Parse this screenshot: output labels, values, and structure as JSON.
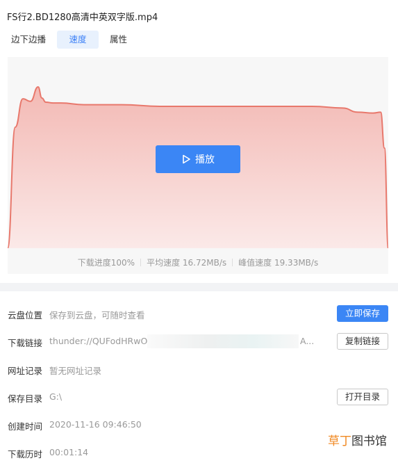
{
  "file": {
    "title": "FS行2.BD1280高清中英双字版.mp4"
  },
  "tabs": [
    {
      "label": "边下边播",
      "active": false
    },
    {
      "label": "速度",
      "active": true
    },
    {
      "label": "属性",
      "active": false
    }
  ],
  "player": {
    "play_label": "播放",
    "play_icon": "play-icon"
  },
  "chart_data": {
    "type": "area",
    "title": "",
    "xlabel": "",
    "ylabel": "",
    "y_unit": "MB/s",
    "ylim": [
      0,
      19.33
    ],
    "x": [
      0,
      2,
      4,
      6,
      8,
      9,
      10,
      12,
      14,
      20,
      30,
      40,
      50,
      60,
      70,
      80,
      88,
      92,
      96,
      98,
      99,
      100
    ],
    "values": [
      0,
      14.5,
      17.9,
      17.6,
      19.33,
      18.0,
      17.5,
      17.4,
      17.4,
      17.2,
      17.2,
      17.0,
      17.0,
      17.0,
      17.0,
      17.0,
      16.8,
      16.3,
      16.2,
      16.3,
      12.0,
      0
    ],
    "grid": false,
    "legend": "none",
    "line_color": "#e8786c",
    "fill_top_color": "#f3b9b4",
    "fill_bottom_color": "#fbe9e8"
  },
  "stats": {
    "progress": "下载进度100%",
    "avg_speed": "平均速度 16.72MB/s",
    "peak_speed": "峰值速度 19.33MB/s"
  },
  "properties": {
    "cloud": {
      "label": "云盘位置",
      "value": "保存到云盘，可随时查看",
      "button": "立即保存"
    },
    "link": {
      "label": "下载链接",
      "value": "thunder://QUFodHRwOi",
      "tail": "A...",
      "button": "复制链接"
    },
    "history": {
      "label": "网址记录",
      "value": "暂无网址记录"
    },
    "save_dir": {
      "label": "保存目录",
      "value": "G:\\",
      "button": "打开目录"
    },
    "created": {
      "label": "创建时间",
      "value": "2020-11-16 09:46:50"
    },
    "duration": {
      "label": "下载历时",
      "value": "00:01:14"
    }
  },
  "watermark": {
    "part1": "草丁",
    "part2": "图书馆"
  },
  "colors": {
    "accent": "#3b86f5",
    "tab_active_bg": "#e8f1fd"
  }
}
